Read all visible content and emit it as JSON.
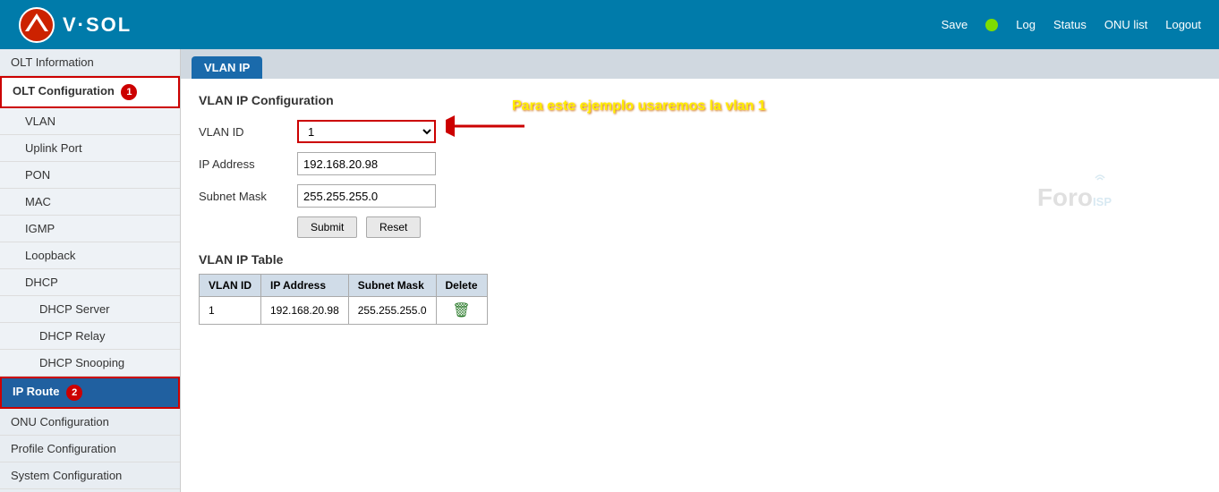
{
  "header": {
    "logo_text": "V·SOL",
    "save_label": "Save",
    "status_dot": "green",
    "nav_items": [
      "Log",
      "Status",
      "ONU list",
      "Logout"
    ]
  },
  "sidebar": {
    "items": [
      {
        "id": "olt-info",
        "label": "OLT Information",
        "level": "top",
        "active": false
      },
      {
        "id": "olt-config",
        "label": "OLT Configuration",
        "level": "top",
        "active": true,
        "badge": "1"
      },
      {
        "id": "vlan",
        "label": "VLAN",
        "level": "sub",
        "active": false
      },
      {
        "id": "uplink-port",
        "label": "Uplink Port",
        "level": "sub",
        "active": false
      },
      {
        "id": "pon",
        "label": "PON",
        "level": "sub",
        "active": false
      },
      {
        "id": "mac",
        "label": "MAC",
        "level": "sub",
        "active": false
      },
      {
        "id": "igmp",
        "label": "IGMP",
        "level": "sub",
        "active": false
      },
      {
        "id": "loopback",
        "label": "Loopback",
        "level": "sub",
        "active": false
      },
      {
        "id": "dhcp",
        "label": "DHCP",
        "level": "sub",
        "active": false
      },
      {
        "id": "dhcp-server",
        "label": "DHCP Server",
        "level": "sub2",
        "active": false
      },
      {
        "id": "dhcp-relay",
        "label": "DHCP Relay",
        "level": "sub2",
        "active": false
      },
      {
        "id": "dhcp-snooping",
        "label": "DHCP Snooping",
        "level": "sub2",
        "active": false
      },
      {
        "id": "ip-route",
        "label": "IP Route",
        "level": "sub",
        "active": true,
        "badge": "2"
      },
      {
        "id": "onu-config",
        "label": "ONU Configuration",
        "level": "top",
        "active": false
      },
      {
        "id": "profile-config",
        "label": "Profile Configuration",
        "level": "top",
        "active": false
      },
      {
        "id": "system-config",
        "label": "System Configuration",
        "level": "top",
        "active": false
      }
    ]
  },
  "tab": {
    "label": "VLAN IP"
  },
  "form": {
    "section_title": "VLAN IP Configuration",
    "annotation": "Para este ejemplo usaremos la vlan 1",
    "fields": [
      {
        "label": "VLAN ID",
        "value": "1",
        "type": "select"
      },
      {
        "label": "IP Address",
        "value": "192.168.20.98",
        "type": "input"
      },
      {
        "label": "Subnet Mask",
        "value": "255.255.255.0",
        "type": "input"
      }
    ],
    "submit_label": "Submit",
    "reset_label": "Reset"
  },
  "table": {
    "title": "VLAN IP Table",
    "columns": [
      "VLAN ID",
      "IP Address",
      "Subnet Mask",
      "Delete"
    ],
    "rows": [
      {
        "vlan_id": "1",
        "ip_address": "192.168.20.98",
        "subnet_mask": "255.255.255.0"
      }
    ]
  },
  "watermark": {
    "text1": "Foro",
    "text2": "ISP"
  }
}
